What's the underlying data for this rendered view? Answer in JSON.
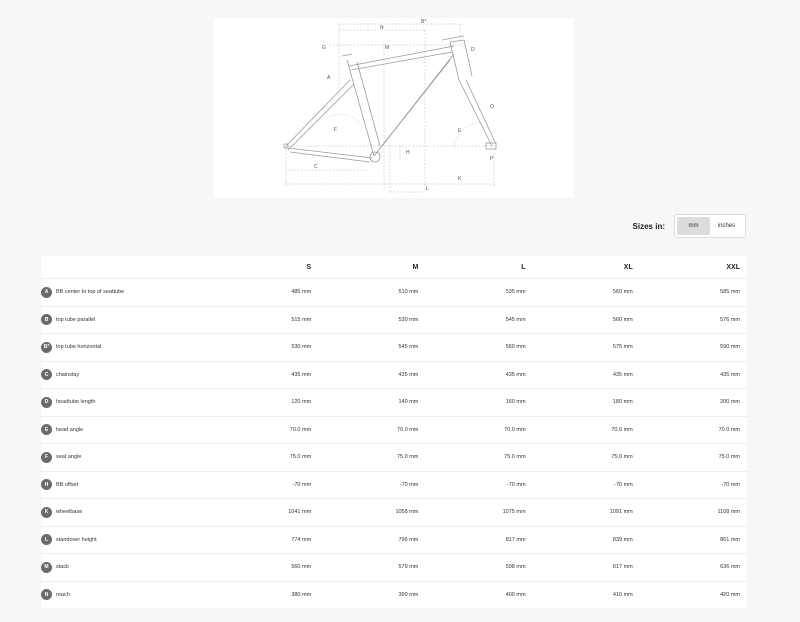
{
  "diagram": {
    "labels": [
      "B*",
      "N",
      "M",
      "G",
      "D",
      "A",
      "O",
      "F",
      "E",
      "H",
      "C",
      "P",
      "L",
      "K"
    ]
  },
  "sizes": {
    "label": "Sizes in:",
    "units": [
      "mm",
      "inches"
    ],
    "active": "mm"
  },
  "table": {
    "headers": [
      "S",
      "M",
      "L",
      "XL",
      "XXL"
    ],
    "rows": [
      {
        "code": "A",
        "label": "BB center to top of seattube",
        "values": [
          "485 mm",
          "510 mm",
          "535 mm",
          "560 mm",
          "585 mm"
        ]
      },
      {
        "code": "B",
        "label": "top tube parallel",
        "values": [
          "515 mm",
          "530 mm",
          "545 mm",
          "560 mm",
          "576 mm"
        ]
      },
      {
        "code": "B*",
        "label": "top tube horizontal",
        "values": [
          "530 mm",
          "545 mm",
          "560 mm",
          "575 mm",
          "590 mm"
        ]
      },
      {
        "code": "C",
        "label": "chainstay",
        "values": [
          "435 mm",
          "435 mm",
          "435 mm",
          "435 mm",
          "435 mm"
        ]
      },
      {
        "code": "D",
        "label": "headtube length",
        "values": [
          "120 mm",
          "140 mm",
          "160 mm",
          "180 mm",
          "200 mm"
        ]
      },
      {
        "code": "E",
        "label": "head angle",
        "values": [
          "70.0 mm",
          "70.0 mm",
          "70.0 mm",
          "70.0 mm",
          "70.0 mm"
        ]
      },
      {
        "code": "F",
        "label": "seat angle",
        "values": [
          "75.0 mm",
          "75.0 mm",
          "75.0 mm",
          "75.0 mm",
          "75.0 mm"
        ]
      },
      {
        "code": "H",
        "label": "BB offset",
        "values": [
          "-70 mm",
          "-70 mm",
          "-70 mm",
          "-70 mm",
          "-70 mm"
        ]
      },
      {
        "code": "K",
        "label": "wheelbase",
        "values": [
          "1041 mm",
          "1058 mm",
          "1075 mm",
          "1091 mm",
          "1108 mm"
        ]
      },
      {
        "code": "L",
        "label": "standover height",
        "values": [
          "774 mm",
          "796 mm",
          "817 mm",
          "839 mm",
          "861 mm"
        ]
      },
      {
        "code": "M",
        "label": "stack",
        "values": [
          "560 mm",
          "579 mm",
          "598 mm",
          "617 mm",
          "636 mm"
        ]
      },
      {
        "code": "N",
        "label": "reach",
        "values": [
          "380 mm",
          "390 mm",
          "400 mm",
          "410 mm",
          "420 mm"
        ]
      }
    ]
  }
}
